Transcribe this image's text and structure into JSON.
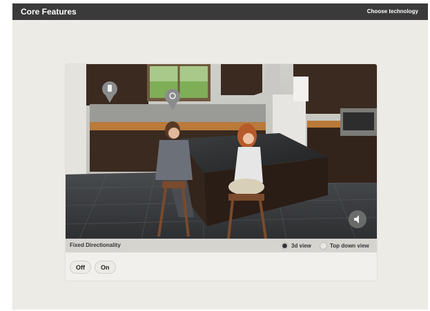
{
  "header": {
    "title": "Core Features",
    "choose_link": "Choose technology"
  },
  "controls": {
    "feature_label": "Fixed Directionality",
    "views": [
      {
        "label": "3d view",
        "selected": true
      },
      {
        "label": "Top down view",
        "selected": false
      }
    ],
    "buttons": {
      "off": "Off",
      "on": "On"
    }
  },
  "icons": {
    "speaker": "speaker-icon",
    "markers": [
      "blender-marker-icon",
      "speech-marker-icon"
    ]
  },
  "colors": {
    "header_bg": "#3a3a3a",
    "page_bg": "#ecebe6"
  }
}
